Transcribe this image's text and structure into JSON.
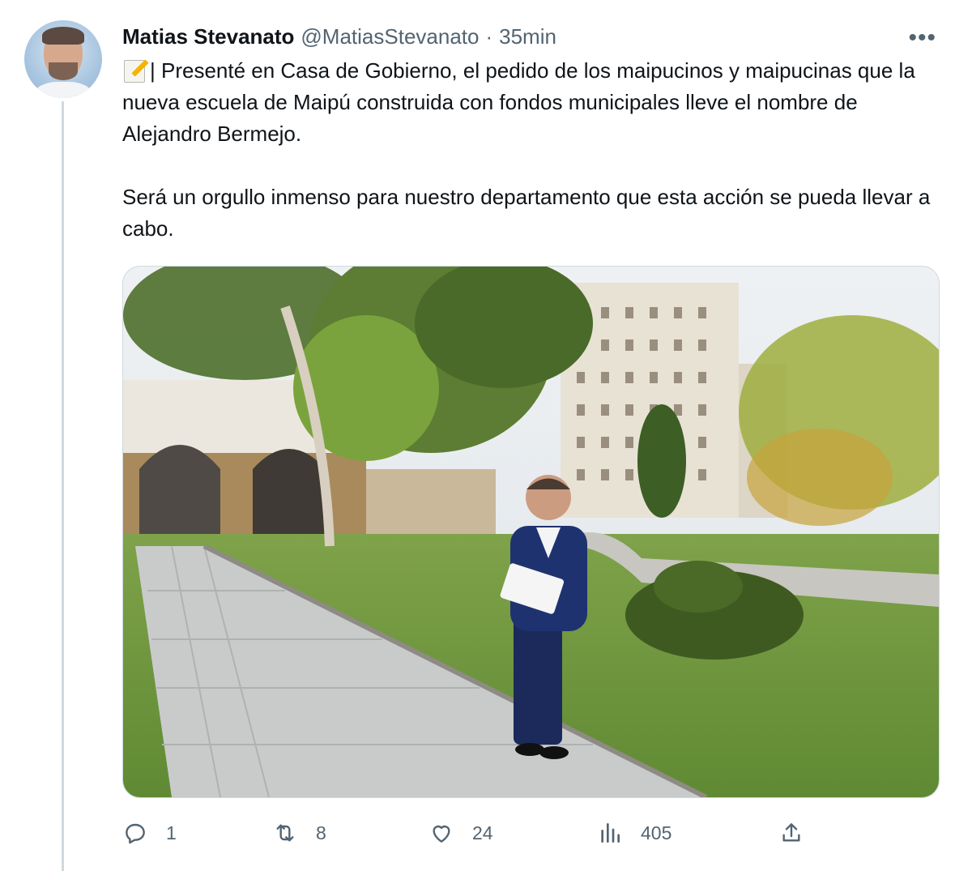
{
  "tweet": {
    "author": {
      "display_name": "Matias Stevanato",
      "handle": "@MatiasStevanato",
      "separator": "·",
      "time": "35min"
    },
    "more_label": "•••",
    "text": {
      "paragraph1": "| Presenté en Casa de Gobierno, el pedido de los maipucinos y maipucinas que la nueva escuela de Maipú construida con fondos municipales lleve el nombre de Alejandro Bermejo.",
      "paragraph2": "Será un orgullo inmenso para nuestro departamento que esta acción se pueda llevar a cabo."
    },
    "leading_emoji": "memo-icon",
    "actions": {
      "reply_count": "1",
      "retweet_count": "8",
      "like_count": "24",
      "views_count": "405"
    },
    "icons": [
      "reply-icon",
      "retweet-icon",
      "like-icon",
      "views-icon",
      "share-icon"
    ]
  },
  "colors": {
    "text_primary": "#0f1419",
    "text_secondary": "#536471",
    "border": "#cfd9de"
  }
}
